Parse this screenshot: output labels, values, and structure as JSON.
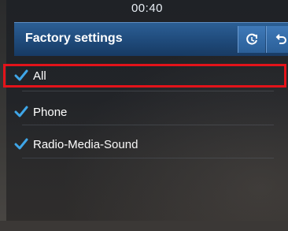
{
  "status": {
    "time": "00:40"
  },
  "header": {
    "title": "Factory settings"
  },
  "icons": {
    "sync": "sync-icon",
    "back": "back-icon",
    "check": "checkmark-icon"
  },
  "items": [
    {
      "label": "All",
      "checked": true,
      "highlighted": true
    },
    {
      "label": "Phone",
      "checked": true
    },
    {
      "label": "Radio-Media-Sound",
      "checked": true
    }
  ],
  "colors": {
    "accent": "#2c5f95",
    "check": "#3fa6e8",
    "highlight": "#e3131a"
  }
}
